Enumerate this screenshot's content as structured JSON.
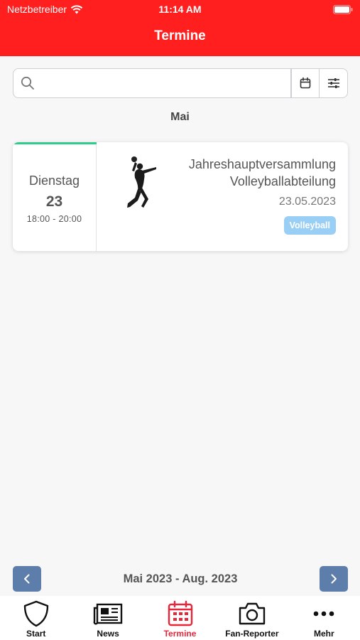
{
  "status_bar": {
    "carrier": "Netzbetreiber",
    "time": "11:14 AM"
  },
  "header": {
    "title": "Termine"
  },
  "search": {
    "placeholder": ""
  },
  "month_heading": "Mai",
  "events": [
    {
      "weekday": "Dienstag",
      "day": "23",
      "time_range": "18:00 - 20:00",
      "title": "Jahreshauptversammlung Volleyballabteilung",
      "date": "23.05.2023",
      "tag": "Volleyball",
      "image": "volleyball-player-silhouette"
    }
  ],
  "range": {
    "label": "Mai 2023 - Aug. 2023"
  },
  "tabs": [
    {
      "label": "Start",
      "icon": "shield-icon",
      "active": false
    },
    {
      "label": "News",
      "icon": "newspaper-icon",
      "active": false
    },
    {
      "label": "Termine",
      "icon": "calendar-icon",
      "active": true
    },
    {
      "label": "Fan-Reporter",
      "icon": "camera-icon",
      "active": false
    },
    {
      "label": "Mehr",
      "icon": "more-dots-icon",
      "active": false
    }
  ],
  "colors": {
    "header": "#ff1f1f",
    "accent": "#e8263a",
    "tag": "#99cff4",
    "nav_button": "#5d7dab",
    "card_topline": "#2ecc8b"
  }
}
